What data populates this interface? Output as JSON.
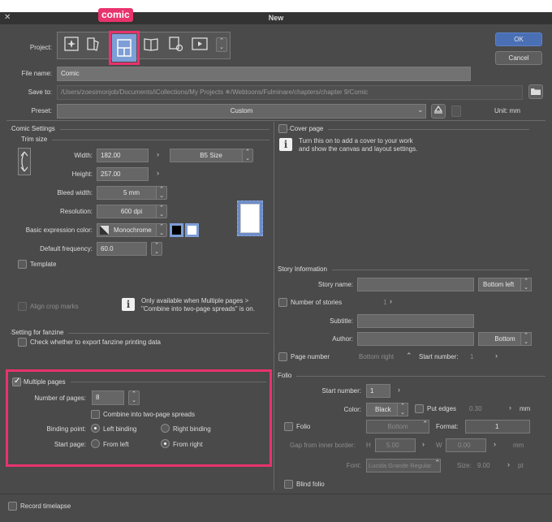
{
  "window": {
    "title": "New",
    "close_glyph": "✕"
  },
  "annotation": {
    "badge": "comic"
  },
  "project": {
    "label": "Project:",
    "icons": [
      "illustration-icon",
      "webtoon-icon",
      "comic-icon",
      "fanzine-icon",
      "print-icon",
      "animation-icon"
    ],
    "selected": "comic-icon"
  },
  "buttons": {
    "ok": "OK",
    "cancel": "Cancel"
  },
  "file_name": {
    "label": "File name:",
    "value": "Comic"
  },
  "save_to": {
    "label": "Save to:",
    "value": "/Users/zoesimonjob/Documents/iCollections/My Projects ✵/Webtoons/Fulminare/chapters/chapter 9/Comic"
  },
  "preset": {
    "label": "Preset:",
    "value": "Custom",
    "unit": "Unit: mm"
  },
  "comic_settings": {
    "title": "Comic Settings",
    "trim_size": "Trim size",
    "width_label": "Width:",
    "width": "182.00",
    "height_label": "Height:",
    "height": "257.00",
    "size_preset": "B5 Size",
    "bleed_label": "Bleed width:",
    "bleed": "5 mm",
    "resolution_label": "Resolution:",
    "resolution": "600 dpi",
    "color_label": "Basic expression color:",
    "color": "Monochrome",
    "freq_label": "Default frequency:",
    "freq": "60.0",
    "template": "Template",
    "align_crop": "Align crop marks",
    "only_available": "Only available when Multiple pages >\n\"Combine into two-page spreads\" is on."
  },
  "fanzine": {
    "title": "Setting for fanzine",
    "check": "Check whether to export fanzine printing data"
  },
  "multiple_pages": {
    "title": "Multiple pages",
    "num_label": "Number of pages:",
    "num": "8",
    "combine": "Combine into two-page spreads",
    "binding_label": "Binding point:",
    "left_binding": "Left binding",
    "right_binding": "Right binding",
    "start_label": "Start page:",
    "from_left": "From left",
    "from_right": "From right"
  },
  "cover": {
    "title": "Cover page",
    "desc": "Turn this on to add a cover to your work\nand show the canvas and layout settings."
  },
  "story": {
    "title": "Story Information",
    "name_label": "Story name:",
    "name_pos": "Bottom left",
    "num_stories": "Number of stories",
    "num_stories_val": "1",
    "subtitle_label": "Subtitle:",
    "author_label": "Author:",
    "author_pos": "Bottom",
    "page_number": "Page number",
    "page_number_pos": "Bottom right",
    "start_number_label": "Start number:",
    "start_number": "1"
  },
  "folio": {
    "title": "Folio",
    "start_label": "Start number:",
    "start": "1",
    "color_label": "Color:",
    "color": "Black",
    "put_edges": "Put edges",
    "edges_val": "0.30",
    "edges_unit": "mm",
    "folio": "Folio",
    "folio_pos": "Bottom",
    "format_label": "Format:",
    "format": "1",
    "gap_label": "Gap from inner border:",
    "h": "H",
    "h_val": "5.00",
    "w": "W",
    "w_val": "0.00",
    "gap_unit": "mm",
    "font_label": "Font:",
    "font": "Lucida Grande Regular",
    "size_label": "Size:",
    "size": "9.00",
    "size_unit": "pt",
    "blind": "Blind folio"
  },
  "footer": {
    "timelapse": "Record timelapse"
  },
  "colors": {
    "accent": "#e8336d",
    "ok_button": "#4a6fb5",
    "panel": "#4a4a4a"
  }
}
